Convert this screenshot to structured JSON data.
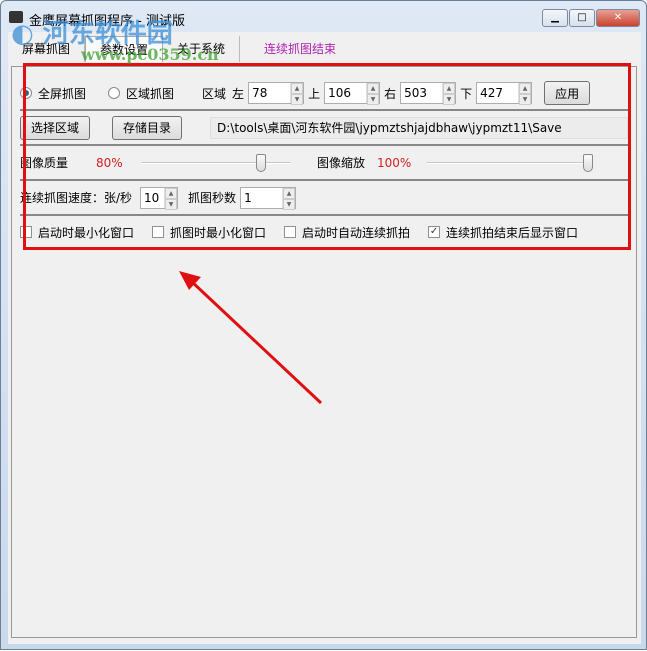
{
  "window": {
    "title": "金鹰屏幕抓图程序 - 测试版",
    "minimize": "▁",
    "maximize": "□",
    "close": "✕"
  },
  "tabs": [
    {
      "label": "屏幕抓图"
    },
    {
      "label": "参数设置"
    },
    {
      "label": "关于系统"
    }
  ],
  "status_link": "连续抓图结束",
  "row1": {
    "fullscreen": "全屏抓图",
    "region": "区域抓图",
    "region_label": "区域",
    "left_label": "左",
    "left": "78",
    "top_label": "上",
    "top": "106",
    "right_label": "右",
    "right": "503",
    "bottom_label": "下",
    "bottom": "427",
    "apply": "应用",
    "selected_mode": "fullscreen"
  },
  "row2": {
    "select_region": "选择区域",
    "save_dir": "存储目录",
    "path": "D:\\tools\\桌面\\河东软件园\\jypmztshjajdbhaw\\jypmzt11\\Save"
  },
  "row3": {
    "quality_label": "图像质量",
    "quality": "80%",
    "quality_value": 80,
    "scale_label": "图像缩放",
    "scale": "100%",
    "scale_value": 100
  },
  "row4": {
    "speed_label": "连续抓图速度：张/秒",
    "speed": "10",
    "seconds_label": "抓图秒数",
    "seconds": "1"
  },
  "row5": {
    "checkboxes": [
      {
        "label": "启动时最小化窗口",
        "checked": false
      },
      {
        "label": "抓图时最小化窗口",
        "checked": false
      },
      {
        "label": "启动时自动连续抓拍",
        "checked": false
      },
      {
        "label": "连续抓拍结束后显示窗口",
        "checked": true
      }
    ]
  },
  "watermark": {
    "text": "河东软件园",
    "url": "www.pc0359.cn"
  },
  "colors": {
    "highlight": "#e01010",
    "percent": "#d02020",
    "link": "#b020b0"
  }
}
